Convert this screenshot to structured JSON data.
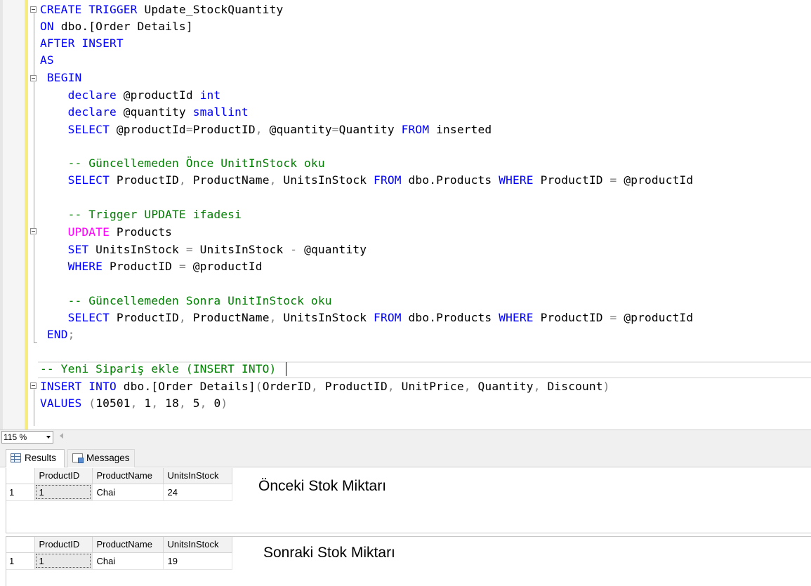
{
  "editor": {
    "lines": [
      "CREATE TRIGGER Update_StockQuantity",
      "ON dbo.[Order Details]",
      "AFTER INSERT",
      "AS",
      " BEGIN",
      "    declare @productId int",
      "    declare @quantity smallint",
      "    SELECT @productId=ProductID, @quantity=Quantity FROM inserted",
      "",
      "    -- Güncellemeden Önce UnitInStock oku",
      "    SELECT ProductID, ProductName, UnitsInStock FROM dbo.Products WHERE ProductID = @productId",
      "",
      "    -- Trigger UPDATE ifadesi",
      "    UPDATE Products",
      "    SET UnitsInStock = UnitsInStock - @quantity",
      "    WHERE ProductID = @productId",
      "",
      "    -- Güncellemeden Sonra UnitInStock oku",
      "    SELECT ProductID, ProductName, UnitsInStock FROM dbo.Products WHERE ProductID = @productId",
      " END;",
      "",
      "-- Yeni Sipariş ekle (INSERT INTO)",
      "INSERT INTO dbo.[Order Details](OrderID, ProductID, UnitPrice, Quantity, Discount)",
      "VALUES (10501, 1, 18, 5, 0)"
    ]
  },
  "zoom": {
    "value": "115 %"
  },
  "tabs": {
    "results": "Results",
    "messages": "Messages"
  },
  "results": {
    "columns": [
      "ProductID",
      "ProductName",
      "UnitsInStock"
    ],
    "grid1": {
      "row_number": "1",
      "cells": [
        "1",
        "Chai",
        "24"
      ]
    },
    "grid2": {
      "row_number": "1",
      "cells": [
        "1",
        "Chai",
        "19"
      ]
    }
  },
  "annotations": {
    "before": "Önceki Stok Miktarı",
    "after": "Sonraki Stok Miktarı"
  },
  "colors": {
    "keyword": "#0000ff",
    "comment": "#008000",
    "function": "#ff00ff",
    "operator": "#808080",
    "change_marker": "#f7ed7c"
  }
}
